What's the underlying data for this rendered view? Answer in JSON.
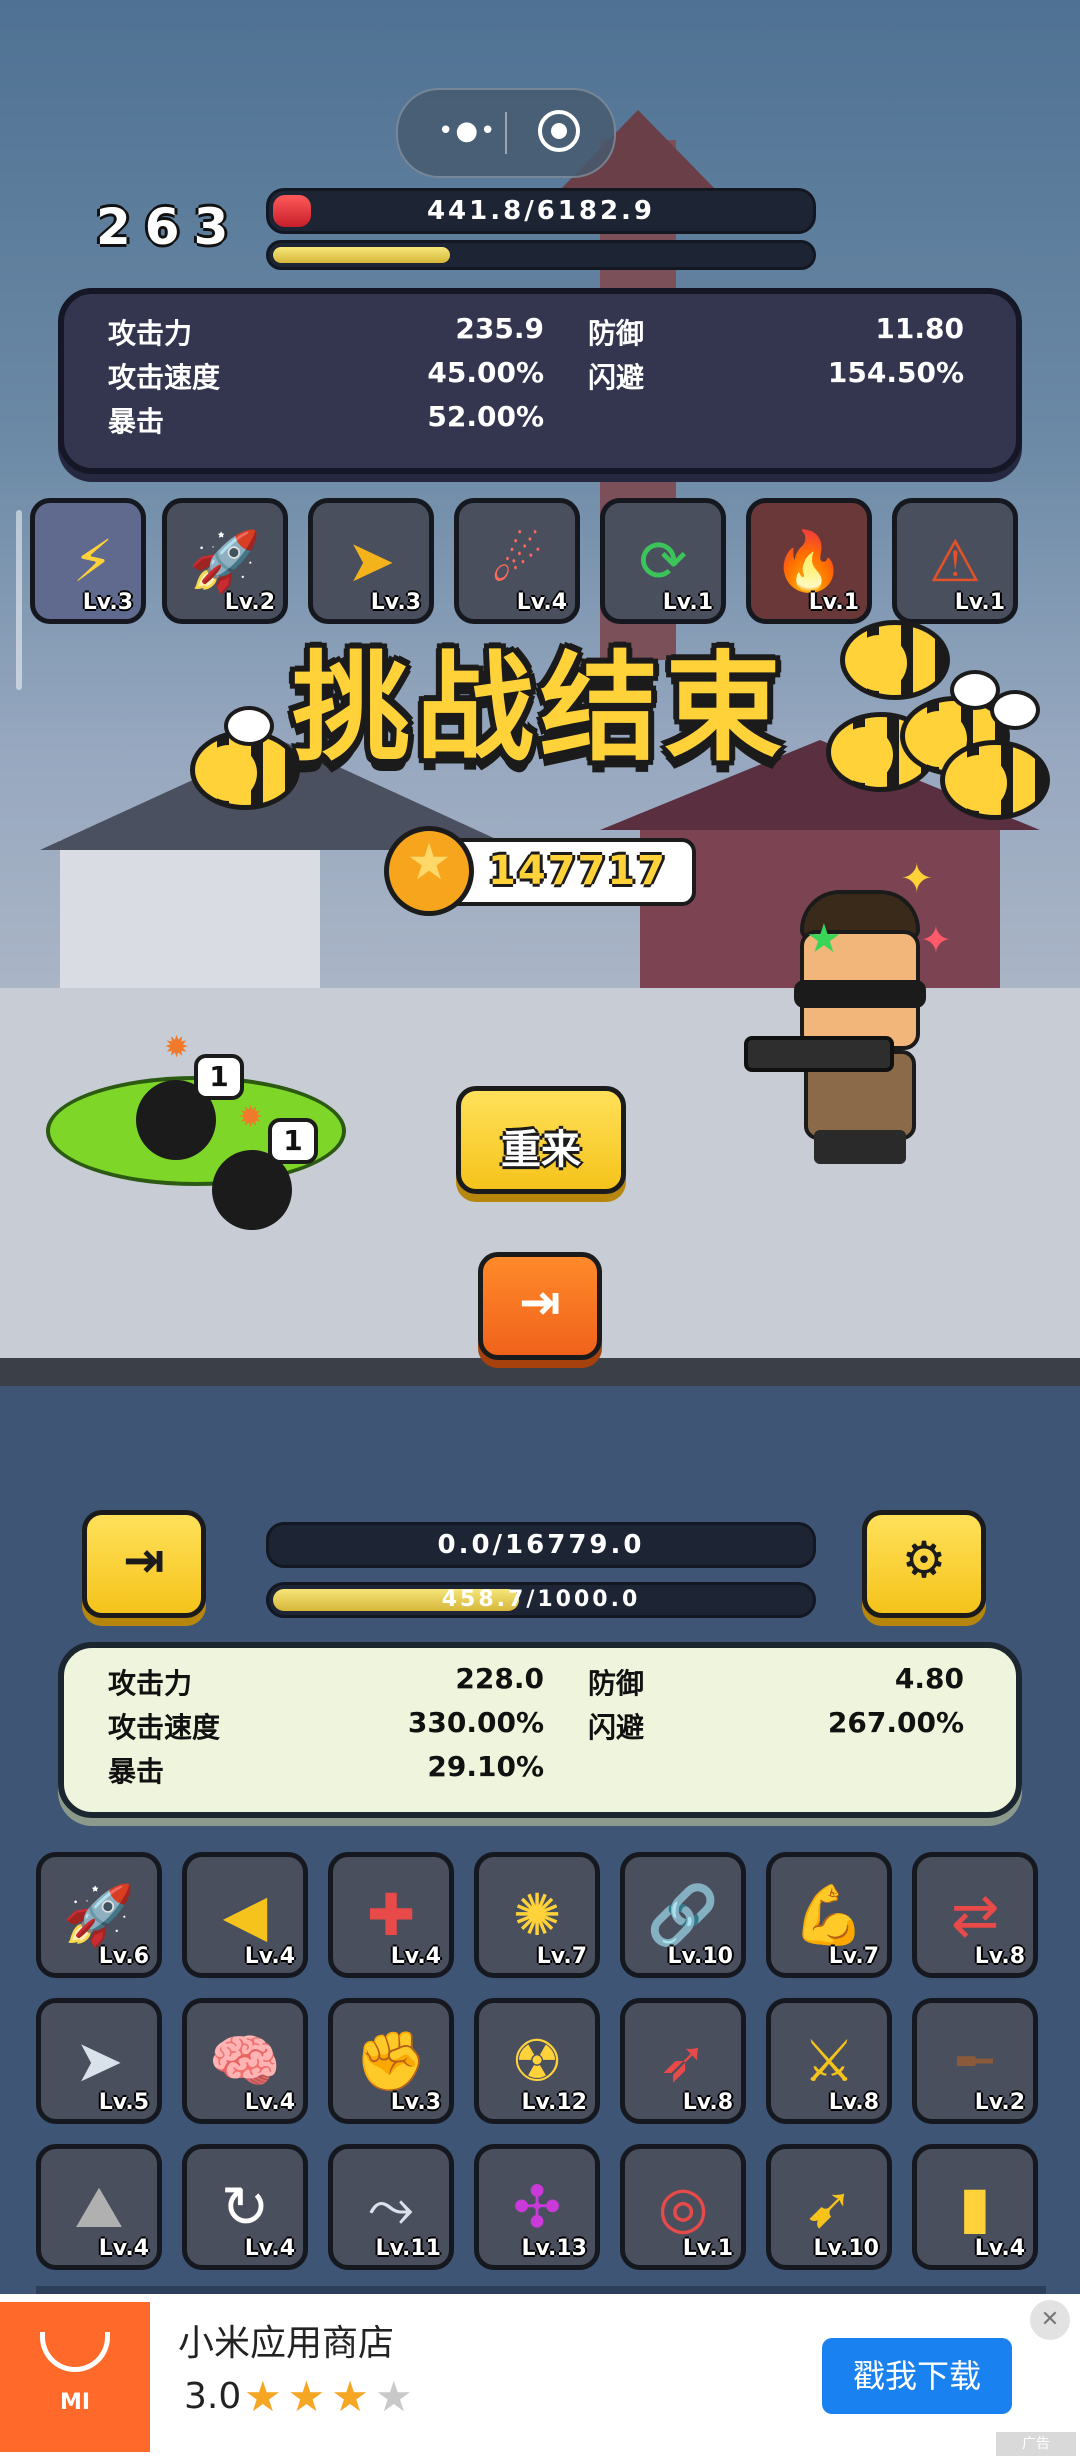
{
  "capsule": {
    "more_icon": "dots-icon",
    "close_icon": "target-icon"
  },
  "enemy": {
    "wave": "263",
    "hp_text": "441.8/6182.9",
    "hp_fill": 0.0715,
    "progress_fill": 0.33,
    "stats": {
      "attack_label": "攻击力",
      "attack_value": "235.9",
      "speed_label": "攻击速度",
      "speed_value": "45.00%",
      "crit_label": "暴击",
      "crit_value": "52.00%",
      "defense_label": "防御",
      "defense_value": "11.80",
      "dodge_label": "闪避",
      "dodge_value": "154.50%"
    },
    "skills": [
      {
        "icon": "lightning-icon",
        "level": "Lv.3"
      },
      {
        "icon": "missile-trail-icon",
        "level": "Lv.2"
      },
      {
        "icon": "bullet-speed-icon",
        "level": "Lv.3"
      },
      {
        "icon": "meteor-icon",
        "level": "Lv.4"
      },
      {
        "icon": "cycle-arrows-icon",
        "level": "Lv.1"
      },
      {
        "icon": "flame-icon",
        "level": "Lv.1"
      },
      {
        "icon": "alert-gauge-icon",
        "level": "Lv.1"
      }
    ]
  },
  "result": {
    "title": "挑战结束",
    "coins": "147717",
    "retry_label": "重来",
    "bomb_counts": [
      "1",
      "1"
    ]
  },
  "player": {
    "hp_text": "0.0/16779.0",
    "hp_fill": 0.0,
    "xp_text": "458.7/1000.0",
    "xp_fill": 0.4587,
    "stats": {
      "attack_label": "攻击力",
      "attack_value": "228.0",
      "speed_label": "攻击速度",
      "speed_value": "330.00%",
      "crit_label": "暴击",
      "crit_value": "29.10%",
      "defense_label": "防御",
      "defense_value": "4.80",
      "dodge_label": "闪避",
      "dodge_value": "267.00%"
    },
    "skills": [
      {
        "icon": "rocket-icon",
        "level": "Lv.6"
      },
      {
        "icon": "arrow-left-icon",
        "level": "Lv.4"
      },
      {
        "icon": "medkit-icon",
        "level": "Lv.4"
      },
      {
        "icon": "gear-burst-icon",
        "level": "Lv.7"
      },
      {
        "icon": "chain-link-icon",
        "level": "Lv.10"
      },
      {
        "icon": "muscle-icon",
        "level": "Lv.7"
      },
      {
        "icon": "swap-arrows-icon",
        "level": "Lv.8"
      },
      {
        "icon": "paper-plane-icon",
        "level": "Lv.5"
      },
      {
        "icon": "brain-icon",
        "level": "Lv.4"
      },
      {
        "icon": "fist-icon",
        "level": "Lv.3"
      },
      {
        "icon": "radiation-icon",
        "level": "Lv.12"
      },
      {
        "icon": "missile-icon",
        "level": "Lv.8"
      },
      {
        "icon": "crossed-swords-icon",
        "level": "Lv.8"
      },
      {
        "icon": "shotgun-icon",
        "level": "Lv.2"
      },
      {
        "icon": "volcano-icon",
        "level": "Lv.4"
      },
      {
        "icon": "recharge-icon",
        "level": "Lv.4"
      },
      {
        "icon": "trajectory-icon",
        "level": "Lv.11"
      },
      {
        "icon": "network-icon",
        "level": "Lv.13"
      },
      {
        "icon": "crosshair-icon",
        "level": "Lv.1"
      },
      {
        "icon": "spear-icon",
        "level": "Lv.10"
      },
      {
        "icon": "battery-icon",
        "level": "Lv.4"
      }
    ]
  },
  "ad": {
    "app_name": "小米应用商店",
    "logo_text": "MI",
    "rating": "3.0",
    "stars": "★★★★",
    "download_label": "戳我下载",
    "tag": "广告",
    "colors": {
      "logo": "#ff6a2a",
      "button": "#1a82f0",
      "star": "#f5a623"
    }
  }
}
